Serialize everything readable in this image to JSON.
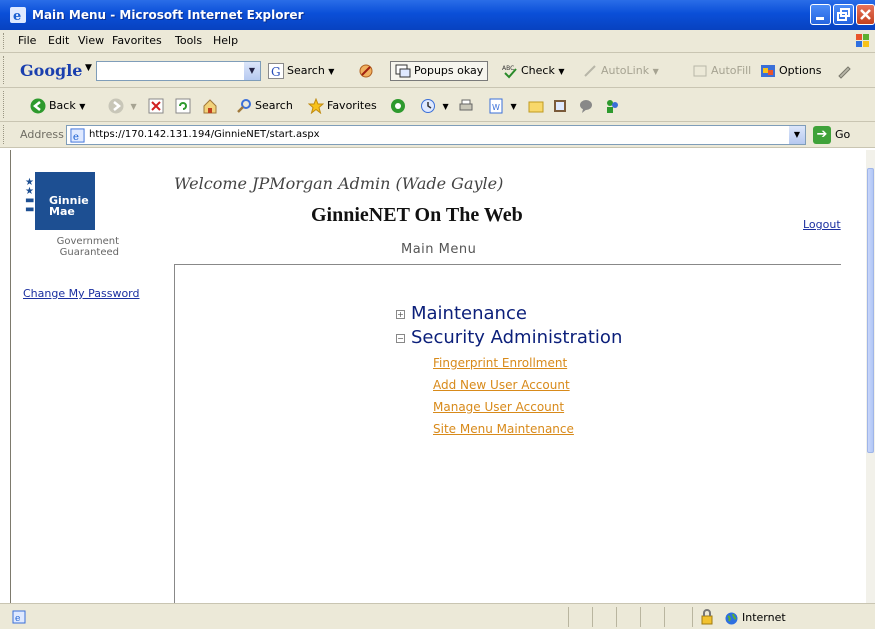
{
  "window": {
    "title": "Main Menu - Microsoft Internet Explorer"
  },
  "menubar": {
    "items": [
      "File",
      "Edit",
      "View",
      "Favorites",
      "Tools",
      "Help"
    ]
  },
  "googlebar": {
    "logo": "Google",
    "search_value": "",
    "search_label": "Search",
    "popups_label": "Popups okay",
    "check_label": "Check",
    "autolink_label": "AutoLink",
    "autofill_label": "AutoFill",
    "options_label": "Options"
  },
  "stdbar": {
    "back_label": "Back",
    "search_label": "Search",
    "favorites_label": "Favorites"
  },
  "address": {
    "label": "Address",
    "url": "https://170.142.131.194/GinnieNET/start.aspx",
    "go_label": "Go"
  },
  "page": {
    "logo_name_line1": "Ginnie",
    "logo_name_line2": "Mae",
    "tagline_line1": "Government",
    "tagline_line2": "Guaranteed",
    "welcome": "Welcome JPMorgan Admin (Wade Gayle)",
    "site_title": "GinnieNET On The Web",
    "logout": "Logout",
    "subtitle": "Main Menu",
    "change_password": "Change My Password",
    "tree": {
      "maintenance": "Maintenance",
      "security": "Security Administration",
      "security_items": [
        "Fingerprint Enrollment",
        "Add New User Account",
        "Manage User Account",
        "Site Menu Maintenance"
      ]
    }
  },
  "status": {
    "zone": "Internet"
  },
  "colors": {
    "titlebar": "#0a4fd8",
    "link_orange": "#d88a1a",
    "tree_blue": "#0b1f7a",
    "logo_blue": "#1d4f92"
  }
}
